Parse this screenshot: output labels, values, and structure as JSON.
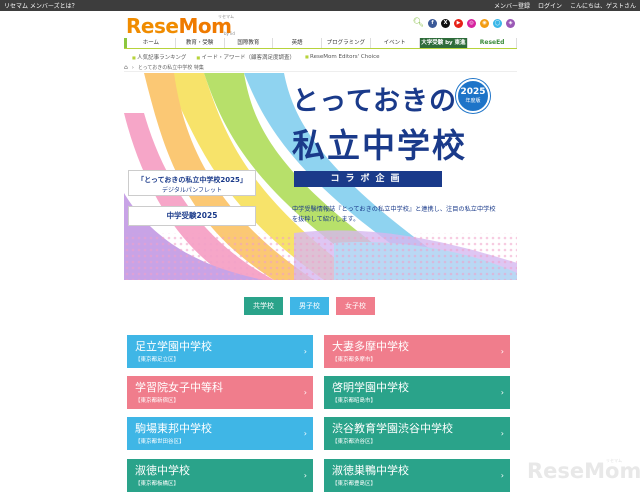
{
  "topbar": {
    "left": "リセマム メンバーズとは？",
    "register": "メンバー登録",
    "login": "ログイン",
    "greeting": "こんにちは、ゲストさん"
  },
  "logo": {
    "text_a": "Rese",
    "text_b": "Mom",
    "kana": "リセマム",
    "sub": "by iid"
  },
  "social_icons": [
    "search-icon",
    "facebook-icon",
    "x-icon",
    "youtube-icon",
    "instagram-icon",
    "rss-icon",
    "line-icon",
    "podcast-icon"
  ],
  "nav": [
    "ホーム",
    "教育・受験",
    "国際教育",
    "英語",
    "プログラミング",
    "イベント",
    "大学受験 by 東進",
    "ReseEd"
  ],
  "subnav": [
    "人気記事ランキング",
    "イード・アワード（顧客満足度調査）",
    "ReseMom Editors' Choice"
  ],
  "breadcrumb": [
    "とっておきの私立中学校 特集"
  ],
  "hero": {
    "title1": "とっておきの",
    "title2": "私立中学校",
    "badge_year": "2025",
    "badge_sub": "年度版",
    "collab": "コラボ企画",
    "desc": "中学受験情報誌『とっておきの私立中学校』と連携し、注目の私立中学校を抜粋して紹介します。",
    "box1_a": "「とっておきの私立中学校2025」",
    "box1_b": "デジタルパンフレット",
    "box2": "中学受験2025"
  },
  "filters": [
    {
      "label": "共学校",
      "color": "#2aa38a"
    },
    {
      "label": "男子校",
      "color": "#3fb6e6"
    },
    {
      "label": "女子校",
      "color": "#f07d8c"
    }
  ],
  "schools": [
    {
      "name": "足立学園中学校",
      "addr": "【東京都足立区】",
      "color": "#3fb6e6"
    },
    {
      "name": "大妻多摩中学校",
      "addr": "【東京都多摩市】",
      "color": "#f07d8c"
    },
    {
      "name": "学習院女子中等科",
      "addr": "【東京都新宿区】",
      "color": "#f07d8c"
    },
    {
      "name": "啓明学園中学校",
      "addr": "【東京都昭島市】",
      "color": "#2aa38a"
    },
    {
      "name": "駒場東邦中学校",
      "addr": "【東京都世田谷区】",
      "color": "#3fb6e6"
    },
    {
      "name": "渋谷教育学園渋谷中学校",
      "addr": "【東京都渋谷区】",
      "color": "#2aa38a"
    },
    {
      "name": "淑徳中学校",
      "addr": "【東京都板橋区】",
      "color": "#2aa38a"
    },
    {
      "name": "淑徳巣鴨中学校",
      "addr": "【東京都豊島区】",
      "color": "#2aa38a"
    }
  ],
  "watermark": {
    "text": "ReseMom",
    "kana": "リセマム"
  }
}
